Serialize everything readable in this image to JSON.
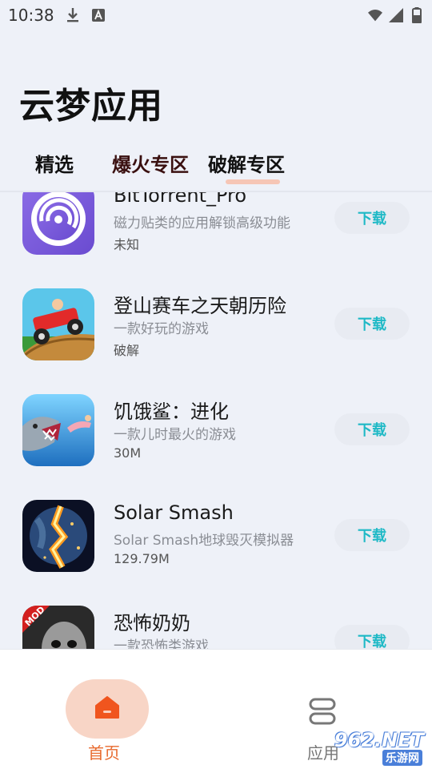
{
  "status_bar": {
    "time": "10:38",
    "icons_left": [
      "download-icon",
      "font-badge-icon"
    ],
    "icons_right": [
      "wifi-icon",
      "cell-signal-icon",
      "battery-icon"
    ]
  },
  "header": {
    "title": "云梦应用",
    "tabs": [
      {
        "label": "精选"
      },
      {
        "label": "爆火专区"
      },
      {
        "label": "破解专区",
        "active": true
      }
    ],
    "indicator_color": "#f6c6b6"
  },
  "apps": [
    {
      "name": "BitTorrent_Pro",
      "desc": "磁力贴类的应用解锁高级功能",
      "meta": "未知",
      "button": "下载",
      "icon": "bittorrent-icon"
    },
    {
      "name": "登山赛车之天朝历险",
      "desc": "一款好玩的游戏",
      "meta": "破解",
      "button": "下载",
      "icon": "hill-climb-racing-icon"
    },
    {
      "name": "饥饿鲨：进化",
      "desc": "一款儿时最火的游戏",
      "meta": "30M",
      "button": "下载",
      "icon": "hungry-shark-icon"
    },
    {
      "name": "Solar Smash",
      "desc": "Solar Smash地球毁灭模拟器",
      "meta": "129.79M",
      "button": "下载",
      "icon": "solar-smash-icon"
    },
    {
      "name": "恐怖奶奶",
      "desc": "一款恐怖类游戏",
      "meta": "",
      "button": "下载",
      "icon": "granny-icon",
      "badge": "MOD"
    }
  ],
  "bottom_nav": {
    "home_label": "首页",
    "apps_label": "应用",
    "active_color": "#e86a2e",
    "accent_color": "#1fb9c6"
  },
  "watermark": {
    "main": "962.NET",
    "sub": "乐游网"
  }
}
